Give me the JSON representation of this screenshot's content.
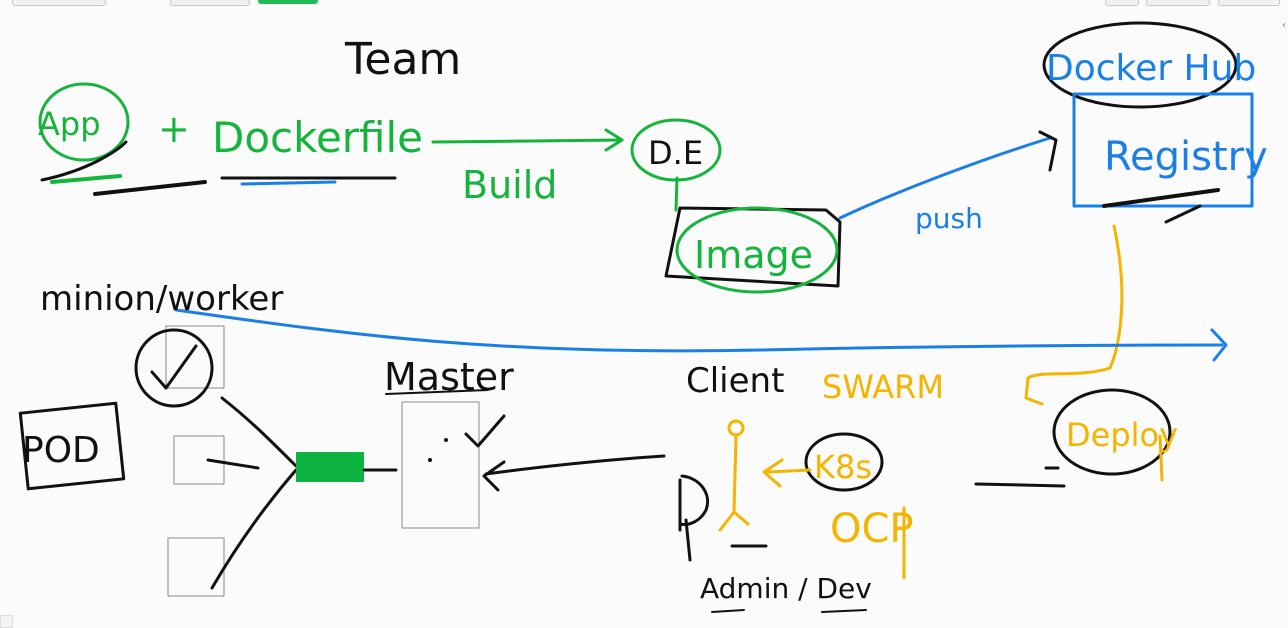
{
  "labels": {
    "team": "Team",
    "app": "App",
    "plus": "+",
    "dockerfile": "Dockerfile",
    "build": "Build",
    "de": "D.E",
    "image": "Image",
    "push": "push",
    "docker_hub": "Docker Hub",
    "registry": "Registry",
    "minion_worker": "minion/worker",
    "pod": "POD",
    "master": "Master",
    "client": "Client",
    "swarm": "SWARM",
    "k8s": "K8s",
    "ocp": "OCP",
    "deploy": "Deploy",
    "admin_dev": "Admin / Dev"
  },
  "colors": {
    "black": "#111111",
    "green": "#15b43c",
    "blue": "#1a7fe6",
    "yellow": "#f4b400",
    "master_link": "#0db33f",
    "box_stroke": "#8a8a8a"
  },
  "icons": {
    "checkmark": "check-circle-icon",
    "person": "person-icon"
  }
}
